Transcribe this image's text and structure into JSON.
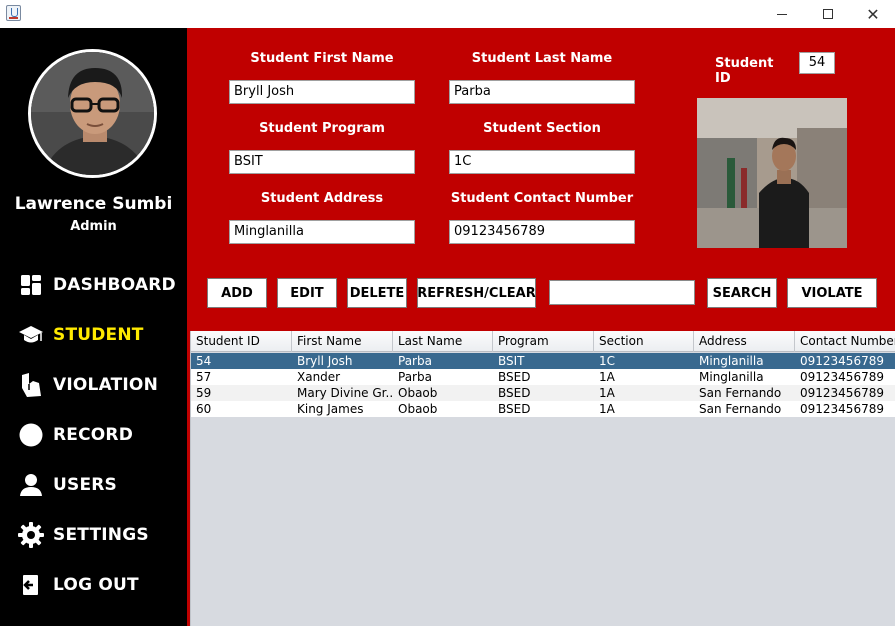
{
  "window": {
    "close_glyph": "✕"
  },
  "sidebar": {
    "user_name": "Lawrence Sumbi",
    "user_role": "Admin",
    "active_color": "#ffea00",
    "items": [
      {
        "label": "DASHBOARD",
        "icon": "dashboard-icon"
      },
      {
        "label": "STUDENT",
        "icon": "graduation-cap-icon"
      },
      {
        "label": "VIOLATION",
        "icon": "violation-hand-icon"
      },
      {
        "label": "RECORD",
        "icon": "record-circle-icon"
      },
      {
        "label": "USERS",
        "icon": "user-icon"
      },
      {
        "label": "SETTINGS",
        "icon": "gear-icon"
      },
      {
        "label": "LOG OUT",
        "icon": "logout-icon"
      }
    ]
  },
  "form": {
    "first_name_label": "Student First Name",
    "first_name_value": "Bryll Josh",
    "last_name_label": "Student Last Name",
    "last_name_value": "Parba",
    "program_label": "Student Program",
    "program_value": "BSIT",
    "section_label": "Student Section",
    "section_value": "1C",
    "address_label": "Student Address",
    "address_value": "Minglanilla",
    "contact_label": "Student Contact Number",
    "contact_value": "09123456789",
    "student_id_label": "Student ID",
    "student_id_value": "54"
  },
  "actions": {
    "add": "ADD",
    "edit": "EDIT",
    "delete": "DELETE",
    "refresh": "REFRESH/CLEAR",
    "search_value": "",
    "search": "SEARCH",
    "violate": "VIOLATE"
  },
  "table": {
    "columns": [
      "Student ID",
      "First Name",
      "Last Name",
      "Program",
      "Section",
      "Address",
      "Contact Number"
    ],
    "rows": [
      [
        "54",
        "Bryll Josh",
        "Parba",
        "BSIT",
        "1C",
        "Minglanilla",
        "09123456789"
      ],
      [
        "57",
        "Xander",
        "Parba",
        "BSED",
        "1A",
        "Minglanilla",
        "09123456789"
      ],
      [
        "59",
        "Mary Divine Gr...",
        "Obaob",
        "BSED",
        "1A",
        "San Fernando",
        "09123456789"
      ],
      [
        "60",
        "King James",
        "Obaob",
        "BSED",
        "1A",
        "San Fernando",
        "09123456789"
      ]
    ]
  },
  "colors": {
    "form_background": "#c00000",
    "sidebar_background": "#000000",
    "selected_row": "#39698f"
  }
}
